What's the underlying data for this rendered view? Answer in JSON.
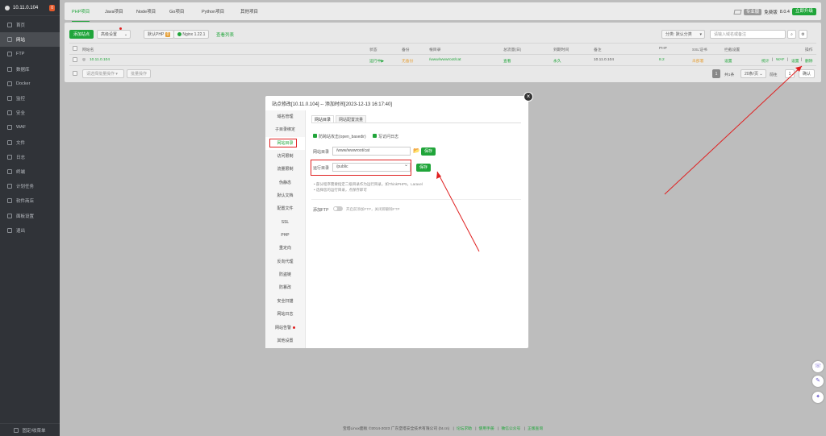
{
  "sidebar": {
    "server": "10.11.0.104",
    "badge": "0",
    "items": [
      {
        "label": "首页"
      },
      {
        "label": "网站"
      },
      {
        "label": "FTP"
      },
      {
        "label": "数据库"
      },
      {
        "label": "Docker"
      },
      {
        "label": "监控"
      },
      {
        "label": "安全"
      },
      {
        "label": "WAF"
      },
      {
        "label": "文件"
      },
      {
        "label": "日志"
      },
      {
        "label": "终端"
      },
      {
        "label": "计划任务"
      },
      {
        "label": "软件商店"
      },
      {
        "label": "面板设置"
      },
      {
        "label": "退出"
      }
    ],
    "footer": "固定/收菜单"
  },
  "topbar": {
    "tabs": [
      "PHP项目",
      "Java项目",
      "Node项目",
      "Go项目",
      "Python项目",
      "其他项目"
    ],
    "pro_label": "专业版",
    "free_label": "免费版",
    "version": "8.0.4",
    "update_label": "立即升级"
  },
  "toolbar": {
    "add_site": "添加站点",
    "advanced": "高级设置",
    "php_cmd": "默认PHP",
    "php_count": "0",
    "nginx": "Nginx 1.22.1",
    "site_list": "查看列表",
    "category_select": "分类: 默认分类",
    "search_placeholder": "请输入域名或备注"
  },
  "table": {
    "headers": [
      "网站名",
      "状态",
      "备份",
      "根目录",
      "总流量(日)",
      "到期时间",
      "备注",
      "PHP",
      "SSL证书",
      "拦截设置",
      "操作"
    ],
    "row": {
      "name": "10.11.0.104",
      "status": "运行中▶",
      "backup": "无备份",
      "root": "/www/wwwroot/cat",
      "traffic": "查看",
      "expire": "永久",
      "note": "10.11.0.104",
      "php": "8.2",
      "ssl": "未部署",
      "intercept": "设置",
      "actions": [
        "统计",
        "WAF",
        "设置",
        "删除"
      ]
    },
    "batch_select": "请选择批量操作",
    "batch_exec": "批量操作",
    "page_current": "1",
    "page_total": "共1条",
    "page_size": "20条/页",
    "goto_label": "前往",
    "goto_page": "1",
    "goto_confirm": "确认"
  },
  "modal": {
    "title": "站点修改[10.11.0.104] -- 添加时间[2023-12-13 16:17:40]",
    "nav": [
      "域名管理",
      "子目录绑定",
      "网站目录",
      "访问限制",
      "流量限制",
      "伪静态",
      "默认文档",
      "配置文件",
      "SSL",
      "PHP",
      "重定向",
      "反向代理",
      "防盗链",
      "防篡改",
      "安全扫描",
      "网站日志",
      "网站告警",
      "其他设置"
    ],
    "tabs": [
      "网站目录",
      "网站配置流量"
    ],
    "chk1": "防跨站攻击(open_basedir)",
    "chk2": "写访问日志",
    "dir_label": "网站目录",
    "dir_value": "/www/wwwroot/cat",
    "run_label": "运行目录",
    "run_value": "/public",
    "save": "保存",
    "note1": "部分程序需要指定二级目录作为运行目录，如ThinkPHP5，Laravel",
    "note2": "选择您的运行目录，点保存即可",
    "ftp_label": "添加FTP",
    "ftp_note": "开启前添加FTP，关闭即删除FTP"
  },
  "footer": {
    "copyright": "宝塔Linux面板 ©2014-2023 广东堡塔安全技术有限公司 (bt.cn)",
    "links": [
      "论坛求助",
      "使用手册",
      "微信公众号",
      "正版查询"
    ]
  },
  "floats": [
    "客服",
    "反馈",
    "AI"
  ],
  "colors": {
    "accent": "#20a53a",
    "danger": "#e02020",
    "sidebar": "#303338"
  }
}
